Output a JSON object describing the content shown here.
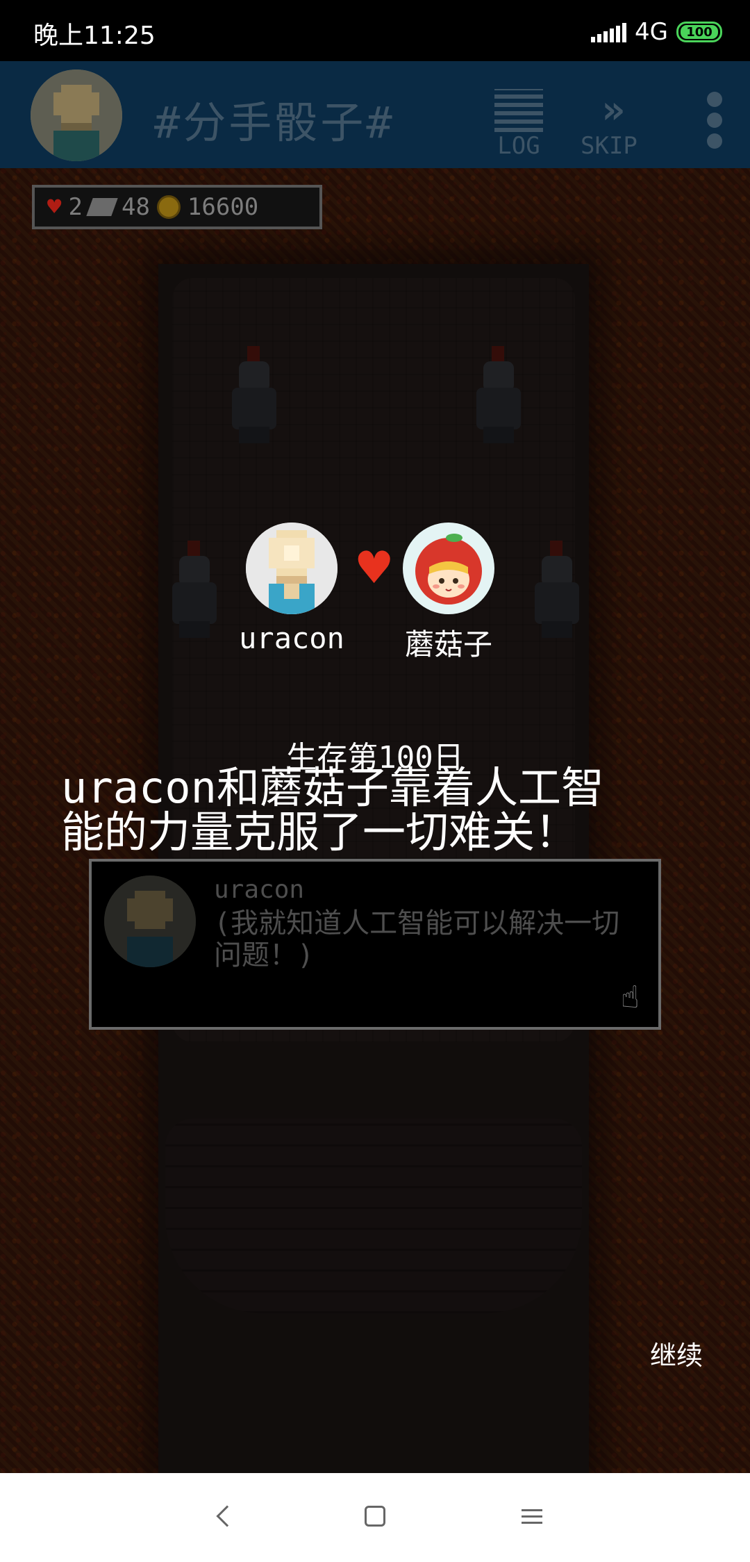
{
  "status_bar": {
    "time": "晚上11:25",
    "network": "4G",
    "battery": "100"
  },
  "app_bar": {
    "title": "#分手骰子#",
    "log_label": "LOG",
    "skip_label": "SKIP",
    "avatar_icon": "player-avatar",
    "more_icon": "more-vertical-icon"
  },
  "resources": {
    "hearts": "2",
    "books": "48",
    "coins": "16600"
  },
  "couple": {
    "left_name": "uracon",
    "right_name": "蘑菇子",
    "heart_icon": "heart-icon"
  },
  "event": {
    "day_title": "生存第100日",
    "headline": "uracon和蘑菇子靠着人工智\n能的力量克服了一切难关！"
  },
  "dialog": {
    "speaker": "uracon",
    "text": "(我就知道人工智能可以解决一切问题！)"
  },
  "continue_label": "继续",
  "colors": {
    "appbar": "#0a2a44",
    "heart": "#e8321e",
    "navbar": "#ffffff"
  }
}
